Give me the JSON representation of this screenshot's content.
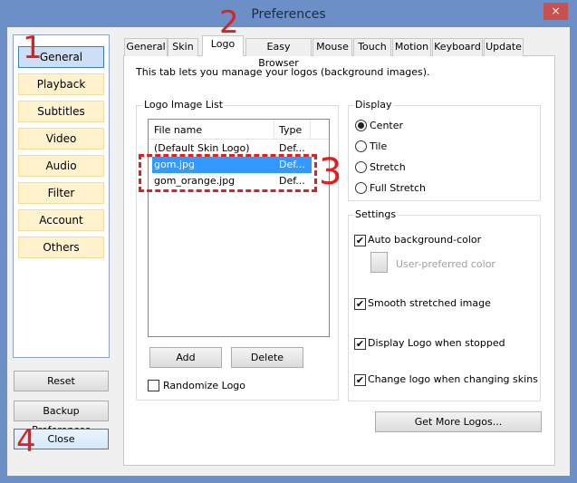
{
  "window": {
    "title": "Preferences",
    "close_icon": "×"
  },
  "sidebar": {
    "items": [
      {
        "label": "General",
        "selected": true
      },
      {
        "label": "Playback"
      },
      {
        "label": "Subtitles"
      },
      {
        "label": "Video"
      },
      {
        "label": "Audio"
      },
      {
        "label": "Filter"
      },
      {
        "label": "Account"
      },
      {
        "label": "Others"
      }
    ],
    "reset": "Reset",
    "backup": "Backup Preferences",
    "close": "Close"
  },
  "tabs": [
    {
      "label": "General"
    },
    {
      "label": "Skin"
    },
    {
      "label": "Logo",
      "selected": true
    },
    {
      "label": "Easy Browser"
    },
    {
      "label": "Mouse"
    },
    {
      "label": "Touch"
    },
    {
      "label": "Motion"
    },
    {
      "label": "Keyboard"
    },
    {
      "label": "Update"
    }
  ],
  "logo": {
    "description": "This tab lets you manage your logos (background images).",
    "list_group": "Logo Image List",
    "columns": [
      "File name",
      "Type"
    ],
    "rows": [
      {
        "name": "(Default Skin Logo)",
        "type": "Def..."
      },
      {
        "name": "gom.jpg",
        "type": "Def...",
        "selected": true
      },
      {
        "name": "gom_orange.jpg",
        "type": "Def..."
      }
    ],
    "add": "Add",
    "delete": "Delete",
    "randomize": "Randomize Logo",
    "randomize_checked": false,
    "display_group": "Display",
    "display_options": [
      {
        "label": "Center",
        "checked": true
      },
      {
        "label": "Tile"
      },
      {
        "label": "Stretch"
      },
      {
        "label": "Full Stretch"
      }
    ],
    "settings_group": "Settings",
    "auto_bg": "Auto background-color",
    "user_color": "User-preferred color",
    "smooth": "Smooth stretched image",
    "display_stopped": "Display Logo when stopped",
    "change_logo": "Change logo when changing skins",
    "get_more": "Get More Logos..."
  },
  "annotations": [
    "1",
    "2",
    "3",
    "4"
  ],
  "colors": {
    "selection": "#3399ff",
    "annotation": "#e02020"
  }
}
